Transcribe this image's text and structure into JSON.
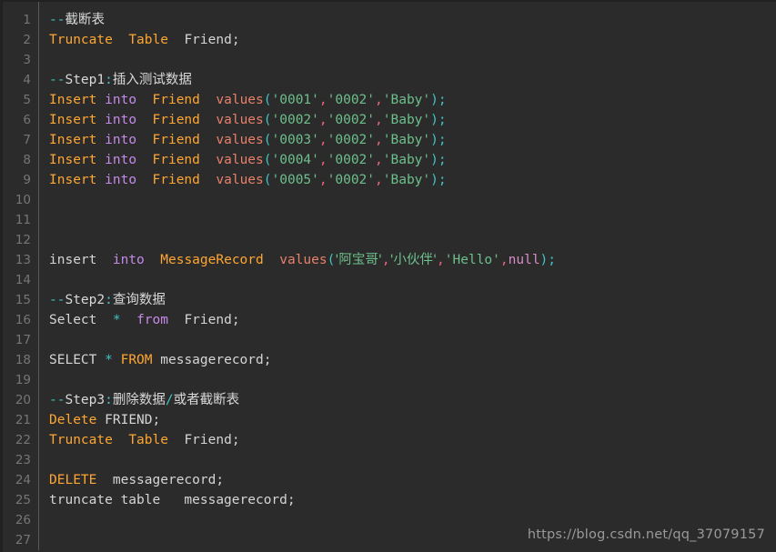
{
  "editor": {
    "background_color": "#2b2b2b",
    "gutter_color": "#2b2b2b",
    "gutter_text_color": "#767676",
    "gutter_separator_color": "#5a5a5a",
    "default_text_color": "#d5d5d5",
    "language": "SQL",
    "first_visible_line": 1,
    "last_visible_line": 27,
    "line_numbers": [
      1,
      2,
      3,
      4,
      5,
      6,
      7,
      8,
      9,
      10,
      11,
      12,
      13,
      14,
      15,
      16,
      17,
      18,
      19,
      20,
      21,
      22,
      23,
      24,
      25,
      26,
      27
    ]
  },
  "palette": {
    "keyword_orange": "#ffa632",
    "keyword_purple": "#c589e8",
    "function_salmon": "#e8806a",
    "string_green": "#6dbf8b",
    "punct_cyan": "#40c4c4",
    "comma_pink": "#e8657d",
    "null_pink": "#d98cc8",
    "plain_white": "#d5d5d5"
  },
  "watermark": {
    "text": "https://blog.csdn.net/qq_37079157"
  },
  "code": {
    "plain_text": "--截断表\nTruncate  Table  Friend;\n\n--Step1:插入测试数据\nInsert into  Friend  values('0001','0002','Baby');\nInsert into  Friend  values('0002','0002','Baby');\nInsert into  Friend  values('0003','0002','Baby');\nInsert into  Friend  values('0004','0002','Baby');\nInsert into  Friend  values('0005','0002','Baby');\n\n\n\ninsert  into  MessageRecord  values('阿宝哥','小伙伴','Hello',null);\n\n--Step2:查询数据\nSelect  *  from  Friend;\n\nSELECT * FROM messagerecord;\n\n--Step3:删除数据/或者截断表\nDelete FRIEND;\nTruncate  Table  Friend;\n\nDELETE  messagerecord;\ntruncate table   messagerecord;\n\n",
    "lines": [
      {
        "n": 1,
        "tokens": [
          {
            "t": "--",
            "c": "punct"
          },
          {
            "t": "截断表",
            "c": "comment"
          }
        ]
      },
      {
        "n": 2,
        "tokens": [
          {
            "t": "Truncate",
            "c": "kw"
          },
          {
            "t": "  ",
            "c": "plain"
          },
          {
            "t": "Table",
            "c": "kw"
          },
          {
            "t": "  ",
            "c": "plain"
          },
          {
            "t": "Friend;",
            "c": "plain"
          }
        ]
      },
      {
        "n": 3,
        "tokens": []
      },
      {
        "n": 4,
        "tokens": [
          {
            "t": "--",
            "c": "punct"
          },
          {
            "t": "Step1",
            "c": "comment"
          },
          {
            "t": ":",
            "c": "punct"
          },
          {
            "t": "插入测试数据",
            "c": "comment"
          }
        ]
      },
      {
        "n": 5,
        "tokens": [
          {
            "t": "Insert",
            "c": "kw"
          },
          {
            "t": " ",
            "c": "plain"
          },
          {
            "t": "into",
            "c": "kw2"
          },
          {
            "t": "  ",
            "c": "plain"
          },
          {
            "t": "Friend",
            "c": "kw"
          },
          {
            "t": "  ",
            "c": "plain"
          },
          {
            "t": "values",
            "c": "func"
          },
          {
            "t": "(",
            "c": "punct"
          },
          {
            "t": "'0001'",
            "c": "str"
          },
          {
            "t": ",",
            "c": "comma"
          },
          {
            "t": "'0002'",
            "c": "str"
          },
          {
            "t": ",",
            "c": "comma"
          },
          {
            "t": "'Baby'",
            "c": "str"
          },
          {
            "t": ")",
            "c": "punct"
          },
          {
            "t": ";",
            "c": "punct"
          }
        ]
      },
      {
        "n": 6,
        "tokens": [
          {
            "t": "Insert",
            "c": "kw"
          },
          {
            "t": " ",
            "c": "plain"
          },
          {
            "t": "into",
            "c": "kw2"
          },
          {
            "t": "  ",
            "c": "plain"
          },
          {
            "t": "Friend",
            "c": "kw"
          },
          {
            "t": "  ",
            "c": "plain"
          },
          {
            "t": "values",
            "c": "func"
          },
          {
            "t": "(",
            "c": "punct"
          },
          {
            "t": "'0002'",
            "c": "str"
          },
          {
            "t": ",",
            "c": "comma"
          },
          {
            "t": "'0002'",
            "c": "str"
          },
          {
            "t": ",",
            "c": "comma"
          },
          {
            "t": "'Baby'",
            "c": "str"
          },
          {
            "t": ")",
            "c": "punct"
          },
          {
            "t": ";",
            "c": "punct"
          }
        ]
      },
      {
        "n": 7,
        "tokens": [
          {
            "t": "Insert",
            "c": "kw"
          },
          {
            "t": " ",
            "c": "plain"
          },
          {
            "t": "into",
            "c": "kw2"
          },
          {
            "t": "  ",
            "c": "plain"
          },
          {
            "t": "Friend",
            "c": "kw"
          },
          {
            "t": "  ",
            "c": "plain"
          },
          {
            "t": "values",
            "c": "func"
          },
          {
            "t": "(",
            "c": "punct"
          },
          {
            "t": "'0003'",
            "c": "str"
          },
          {
            "t": ",",
            "c": "comma"
          },
          {
            "t": "'0002'",
            "c": "str"
          },
          {
            "t": ",",
            "c": "comma"
          },
          {
            "t": "'Baby'",
            "c": "str"
          },
          {
            "t": ")",
            "c": "punct"
          },
          {
            "t": ";",
            "c": "punct"
          }
        ]
      },
      {
        "n": 8,
        "tokens": [
          {
            "t": "Insert",
            "c": "kw"
          },
          {
            "t": " ",
            "c": "plain"
          },
          {
            "t": "into",
            "c": "kw2"
          },
          {
            "t": "  ",
            "c": "plain"
          },
          {
            "t": "Friend",
            "c": "kw"
          },
          {
            "t": "  ",
            "c": "plain"
          },
          {
            "t": "values",
            "c": "func"
          },
          {
            "t": "(",
            "c": "punct"
          },
          {
            "t": "'0004'",
            "c": "str"
          },
          {
            "t": ",",
            "c": "comma"
          },
          {
            "t": "'0002'",
            "c": "str"
          },
          {
            "t": ",",
            "c": "comma"
          },
          {
            "t": "'Baby'",
            "c": "str"
          },
          {
            "t": ")",
            "c": "punct"
          },
          {
            "t": ";",
            "c": "punct"
          }
        ]
      },
      {
        "n": 9,
        "tokens": [
          {
            "t": "Insert",
            "c": "kw"
          },
          {
            "t": " ",
            "c": "plain"
          },
          {
            "t": "into",
            "c": "kw2"
          },
          {
            "t": "  ",
            "c": "plain"
          },
          {
            "t": "Friend",
            "c": "kw"
          },
          {
            "t": "  ",
            "c": "plain"
          },
          {
            "t": "values",
            "c": "func"
          },
          {
            "t": "(",
            "c": "punct"
          },
          {
            "t": "'0005'",
            "c": "str"
          },
          {
            "t": ",",
            "c": "comma"
          },
          {
            "t": "'0002'",
            "c": "str"
          },
          {
            "t": ",",
            "c": "comma"
          },
          {
            "t": "'Baby'",
            "c": "str"
          },
          {
            "t": ")",
            "c": "punct"
          },
          {
            "t": ";",
            "c": "punct"
          }
        ]
      },
      {
        "n": 10,
        "tokens": []
      },
      {
        "n": 11,
        "tokens": []
      },
      {
        "n": 12,
        "tokens": []
      },
      {
        "n": 13,
        "tokens": [
          {
            "t": "insert",
            "c": "plain"
          },
          {
            "t": "  ",
            "c": "plain"
          },
          {
            "t": "into",
            "c": "kw2"
          },
          {
            "t": "  ",
            "c": "plain"
          },
          {
            "t": "MessageRecord",
            "c": "kw"
          },
          {
            "t": "  ",
            "c": "plain"
          },
          {
            "t": "values",
            "c": "func"
          },
          {
            "t": "(",
            "c": "punct"
          },
          {
            "t": "'阿宝哥'",
            "c": "str"
          },
          {
            "t": ",",
            "c": "comma"
          },
          {
            "t": "'小伙伴'",
            "c": "str"
          },
          {
            "t": ",",
            "c": "comma"
          },
          {
            "t": "'Hello'",
            "c": "str"
          },
          {
            "t": ",",
            "c": "comma"
          },
          {
            "t": "null",
            "c": "null"
          },
          {
            "t": ")",
            "c": "punct"
          },
          {
            "t": ";",
            "c": "punct"
          }
        ]
      },
      {
        "n": 14,
        "tokens": []
      },
      {
        "n": 15,
        "tokens": [
          {
            "t": "--",
            "c": "punct"
          },
          {
            "t": "Step2",
            "c": "comment"
          },
          {
            "t": ":",
            "c": "punct"
          },
          {
            "t": "查询数据",
            "c": "comment"
          }
        ]
      },
      {
        "n": 16,
        "tokens": [
          {
            "t": "Select",
            "c": "plain"
          },
          {
            "t": "  ",
            "c": "plain"
          },
          {
            "t": "*",
            "c": "punct"
          },
          {
            "t": "  ",
            "c": "plain"
          },
          {
            "t": "from",
            "c": "kw2"
          },
          {
            "t": "  ",
            "c": "plain"
          },
          {
            "t": "Friend;",
            "c": "plain"
          }
        ]
      },
      {
        "n": 17,
        "tokens": []
      },
      {
        "n": 18,
        "tokens": [
          {
            "t": "SELECT",
            "c": "plain"
          },
          {
            "t": " ",
            "c": "plain"
          },
          {
            "t": "*",
            "c": "punct"
          },
          {
            "t": " ",
            "c": "plain"
          },
          {
            "t": "FROM",
            "c": "kw"
          },
          {
            "t": " ",
            "c": "plain"
          },
          {
            "t": "messagerecord;",
            "c": "plain"
          }
        ]
      },
      {
        "n": 19,
        "tokens": []
      },
      {
        "n": 20,
        "tokens": [
          {
            "t": "--",
            "c": "punct"
          },
          {
            "t": "Step3",
            "c": "comment"
          },
          {
            "t": ":",
            "c": "punct"
          },
          {
            "t": "删除数据",
            "c": "comment"
          },
          {
            "t": "/",
            "c": "punct"
          },
          {
            "t": "或者截断表",
            "c": "comment"
          }
        ]
      },
      {
        "n": 21,
        "tokens": [
          {
            "t": "Delete",
            "c": "kw"
          },
          {
            "t": " ",
            "c": "plain"
          },
          {
            "t": "FRIEND;",
            "c": "plain"
          }
        ]
      },
      {
        "n": 22,
        "tokens": [
          {
            "t": "Truncate",
            "c": "kw"
          },
          {
            "t": "  ",
            "c": "plain"
          },
          {
            "t": "Table",
            "c": "kw"
          },
          {
            "t": "  ",
            "c": "plain"
          },
          {
            "t": "Friend;",
            "c": "plain"
          }
        ]
      },
      {
        "n": 23,
        "tokens": []
      },
      {
        "n": 24,
        "tokens": [
          {
            "t": "DELETE",
            "c": "kw"
          },
          {
            "t": "  ",
            "c": "plain"
          },
          {
            "t": "messagerecord;",
            "c": "plain"
          }
        ]
      },
      {
        "n": 25,
        "tokens": [
          {
            "t": "truncate table   messagerecord;",
            "c": "plain"
          }
        ]
      },
      {
        "n": 26,
        "tokens": []
      },
      {
        "n": 27,
        "tokens": []
      }
    ]
  }
}
